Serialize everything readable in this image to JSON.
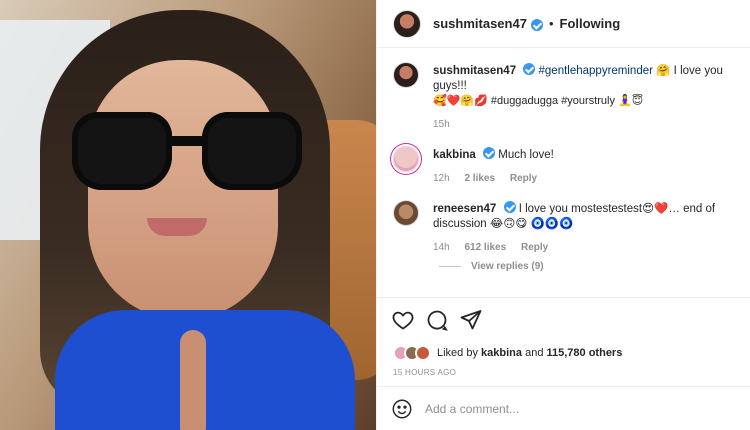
{
  "photo": {
    "alt_icon": "photo"
  },
  "header": {
    "username": "sushmitasen47",
    "separator": "•",
    "following": "Following"
  },
  "caption": {
    "username": "sushmitasen47",
    "text_part1": "#gentlehappyreminder",
    "text_part2": " 🤗 I love you guys!!!",
    "text_line2": "🥰❤️🤗💋 #duggadugga #yourstruly 🧘‍♀️😇",
    "time": "15h"
  },
  "comments": [
    {
      "username": "kakbina",
      "text": "Much love!",
      "time": "12h",
      "likes": "2 likes",
      "reply": "Reply"
    },
    {
      "username": "reneesen47",
      "text": "I love you mostestestest😍❤️… end of discussion 😂🙃😋 🧿🧿🧿",
      "time": "14h",
      "likes": "612 likes",
      "reply": "Reply"
    }
  ],
  "view_replies": "View replies (9)",
  "footer": {
    "liked_by_prefix": "Liked by ",
    "liked_by_user": "kakbina",
    "liked_by_mid": " and ",
    "liked_by_others": "115,780 others",
    "timestamp": "15 HOURS AGO",
    "add_comment_placeholder": "Add a comment..."
  }
}
